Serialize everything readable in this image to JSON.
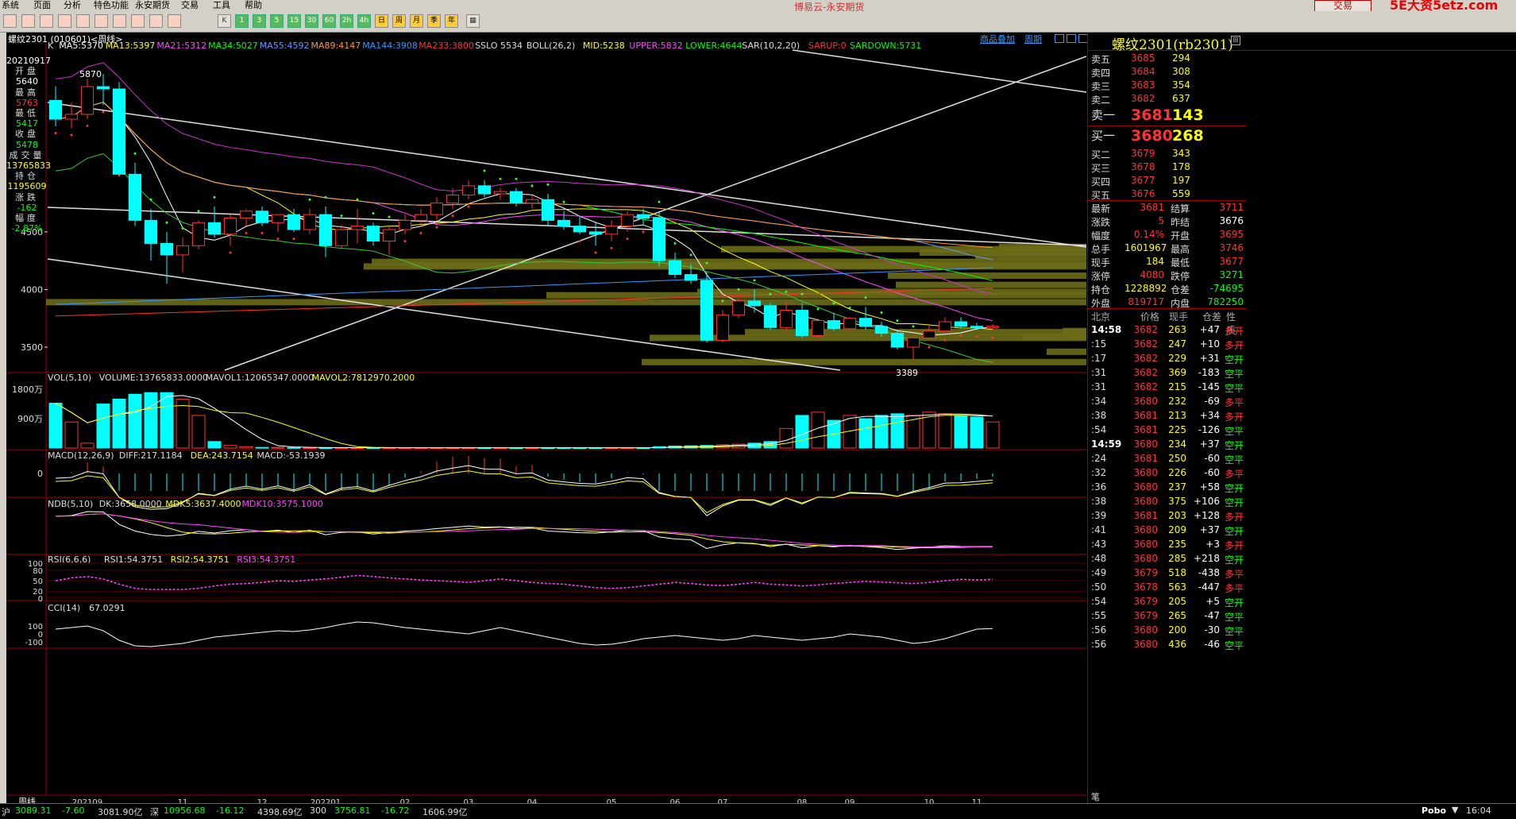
{
  "menu": {
    "items": [
      "系统",
      "页面",
      "分析",
      "特色功能",
      "永安期货",
      "交易",
      "工具",
      "帮助"
    ],
    "title": "博易云-永安期货",
    "trade_button": "交易",
    "brand": "5E大资5etz.com"
  },
  "toolbar": {
    "buttons": [
      "K",
      "1",
      "3",
      "5",
      "15",
      "30",
      "60",
      "2h",
      "4h",
      "日",
      "周",
      "月",
      "季",
      "年"
    ]
  },
  "chart": {
    "symbol_label": "螺纹2301 (010601)<周线>",
    "links": [
      "商品叠加",
      "周期"
    ],
    "ma_line": [
      {
        "text": "K",
        "color": "#dddddd"
      },
      {
        "text": "MA5:5370",
        "color": "#ffffff"
      },
      {
        "text": "MA13:5397",
        "color": "#ffff00"
      },
      {
        "text": "MA21:5312",
        "color": "#ff44ff"
      },
      {
        "text": "MA34:5027",
        "color": "#00ff00"
      },
      {
        "text": "MA55:4592",
        "color": "#6699ff"
      },
      {
        "text": "MA89:4147",
        "color": "#ff9933"
      },
      {
        "text": "MA144:3908",
        "color": "#3399ff"
      },
      {
        "text": "MA233:3800",
        "color": "#ff3333"
      },
      {
        "text": "SSLO 5534",
        "color": "#dddddd"
      },
      {
        "text": "BOLL(26,2)",
        "color": "#dddddd"
      },
      {
        "text": "MID:5238",
        "color": "#ffff00"
      },
      {
        "text": "UPPER:5832",
        "color": "#ff44ff"
      },
      {
        "text": "LOWER:4644",
        "color": "#00ff00"
      },
      {
        "text": "SAR(10,2,20)",
        "color": "#dddddd"
      },
      {
        "text": "SARUP:0",
        "color": "#ff3333"
      },
      {
        "text": "SARDOWN:5731",
        "color": "#00ff00"
      }
    ],
    "y_ticks": [
      "4500",
      "4000",
      "3500"
    ],
    "annot_high": "5870",
    "annot_low": "3389",
    "vol_header": [
      {
        "text": "VOL(5,10)",
        "color": "#dddddd"
      },
      {
        "text": "VOLUME:13765833.0000",
        "color": "#dddddd"
      },
      {
        "text": "MAVOL1:12065347.0000",
        "color": "#dddddd"
      },
      {
        "text": "MAVOL2:7812970.2000",
        "color": "#ffff00"
      }
    ],
    "vol_ticks": [
      "1800万",
      "900万"
    ],
    "macd_header": [
      {
        "text": "MACD(12,26,9)",
        "color": "#dddddd"
      },
      {
        "text": "DIFF:217.1184",
        "color": "#dddddd"
      },
      {
        "text": "DEA:243.7154",
        "color": "#ffff00"
      },
      {
        "text": "MACD:-53.1939",
        "color": "#dddddd"
      }
    ],
    "macd_tick": "0",
    "ndb_header": [
      {
        "text": "NDB(5,10)",
        "color": "#dddddd"
      },
      {
        "text": "DK:3658.0000",
        "color": "#dddddd"
      },
      {
        "text": "MDK5:3637.4000",
        "color": "#ffff00"
      },
      {
        "text": "MDK10:3575.1000",
        "color": "#ff44ff"
      }
    ],
    "rsi_header": [
      {
        "text": "RSI(6,6,6)",
        "color": "#dddddd"
      },
      {
        "text": "RSI1:54.3751",
        "color": "#dddddd"
      },
      {
        "text": "RSI2:54.3751",
        "color": "#ffff00"
      },
      {
        "text": "RSI3:54.3751",
        "color": "#ff44ff"
      }
    ],
    "rsi_ticks": [
      "100",
      "80",
      "50",
      "20",
      "0"
    ],
    "cci_header": [
      {
        "text": "CCI(14)",
        "color": "#dddddd"
      },
      {
        "text": "67.0291",
        "color": "#dddddd"
      }
    ],
    "cci_ticks": [
      "100",
      "0",
      "-100"
    ],
    "x_labels": [
      "202109",
      "11",
      "12",
      "202201",
      "02",
      "03",
      "04",
      "05",
      "06",
      "07",
      "08",
      "09",
      "10",
      "11"
    ],
    "period_label": "周线"
  },
  "info": {
    "date": "20210917",
    "rows": [
      {
        "label": "开盘",
        "value": "5640",
        "color": "#ffffff"
      },
      {
        "label": "最高",
        "value": "5763",
        "color": "#ff3333"
      },
      {
        "label": "最低",
        "value": "5417",
        "color": "#00ff00"
      },
      {
        "label": "收盘",
        "value": "5478",
        "color": "#00ff00"
      },
      {
        "label": "成交量",
        "value": "13765833",
        "color": "#ffff00"
      },
      {
        "label": "持仓",
        "value": "1195609",
        "color": "#ffff00"
      },
      {
        "label": "涨跌",
        "value": "-162",
        "color": "#00ff00"
      },
      {
        "label": "幅度",
        "value": "-2.87%",
        "color": "#00ff00"
      }
    ]
  },
  "chart_data": {
    "type": "candlestick",
    "periods": 60,
    "price_range": [
      3300,
      6050
    ],
    "candles": [
      [
        5640,
        5763,
        5417,
        5478
      ],
      [
        5478,
        5620,
        5400,
        5520
      ],
      [
        5520,
        5830,
        5480,
        5760
      ],
      [
        5760,
        5870,
        5600,
        5740
      ],
      [
        5740,
        5800,
        5050,
        5000
      ],
      [
        5000,
        5100,
        4550,
        4600
      ],
      [
        4600,
        4700,
        4250,
        4400
      ],
      [
        4400,
        4500,
        4050,
        4300
      ],
      [
        4300,
        4450,
        4150,
        4380
      ],
      [
        4380,
        4600,
        4350,
        4580
      ],
      [
        4580,
        4720,
        4450,
        4480
      ],
      [
        4480,
        4650,
        4380,
        4620
      ],
      [
        4620,
        4700,
        4550,
        4680
      ],
      [
        4680,
        4720,
        4550,
        4580
      ],
      [
        4580,
        4650,
        4500,
        4650
      ],
      [
        4650,
        4700,
        4500,
        4520
      ],
      [
        4520,
        4700,
        4480,
        4650
      ],
      [
        4650,
        4720,
        4280,
        4380
      ],
      [
        4380,
        4560,
        4350,
        4520
      ],
      [
        4520,
        4700,
        4400,
        4550
      ],
      [
        4550,
        4580,
        4380,
        4420
      ],
      [
        4420,
        4550,
        4300,
        4520
      ],
      [
        4520,
        4650,
        4480,
        4600
      ],
      [
        4600,
        4700,
        4550,
        4650
      ],
      [
        4650,
        4800,
        4600,
        4750
      ],
      [
        4750,
        4880,
        4700,
        4820
      ],
      [
        4820,
        4950,
        4780,
        4900
      ],
      [
        4900,
        4950,
        4800,
        4830
      ],
      [
        4830,
        4880,
        4780,
        4850
      ],
      [
        4850,
        4880,
        4720,
        4750
      ],
      [
        4750,
        4820,
        4700,
        4780
      ],
      [
        4780,
        4830,
        4550,
        4600
      ],
      [
        4600,
        4680,
        4520,
        4550
      ],
      [
        4550,
        4640,
        4480,
        4500
      ],
      [
        4500,
        4580,
        4380,
        4480
      ],
      [
        4480,
        4600,
        4420,
        4550
      ],
      [
        4550,
        4680,
        4500,
        4650
      ],
      [
        4650,
        4700,
        4560,
        4620
      ],
      [
        4620,
        4680,
        4200,
        4250
      ],
      [
        4250,
        4320,
        4100,
        4130
      ],
      [
        4130,
        4220,
        4050,
        4080
      ],
      [
        4080,
        4150,
        3540,
        3560
      ],
      [
        3560,
        3820,
        3540,
        3780
      ],
      [
        3780,
        3920,
        3750,
        3900
      ],
      [
        3900,
        4000,
        3800,
        3860
      ],
      [
        3860,
        3880,
        3650,
        3670
      ],
      [
        3670,
        3900,
        3640,
        3820
      ],
      [
        3820,
        3880,
        3580,
        3600
      ],
      [
        3600,
        3750,
        3580,
        3730
      ],
      [
        3730,
        3800,
        3640,
        3660
      ],
      [
        3660,
        3760,
        3640,
        3750
      ],
      [
        3750,
        3850,
        3650,
        3680
      ],
      [
        3680,
        3720,
        3590,
        3620
      ],
      [
        3620,
        3650,
        3480,
        3500
      ],
      [
        3500,
        3600,
        3389,
        3580
      ],
      [
        3580,
        3700,
        3560,
        3640
      ],
      [
        3640,
        3760,
        3620,
        3720
      ],
      [
        3720,
        3760,
        3660,
        3681
      ],
      [
        3681,
        3710,
        3650,
        3670
      ],
      [
        3670,
        3700,
        3640,
        3681
      ]
    ],
    "volume_wan": [
      1376,
      800,
      150,
      1350,
      1500,
      1650,
      1700,
      1700,
      1500,
      1000,
      200,
      80,
      40,
      20,
      20,
      15,
      10,
      10,
      10,
      10,
      10,
      10,
      10,
      10,
      10,
      10,
      10,
      10,
      10,
      10,
      10,
      10,
      10,
      10,
      10,
      10,
      10,
      10,
      40,
      60,
      70,
      80,
      100,
      120,
      150,
      200,
      600,
      1000,
      1100,
      850,
      1000,
      900,
      1000,
      1050,
      1000,
      1100,
      1050,
      1000,
      950,
      800
    ],
    "rsi": [
      50,
      58,
      62,
      55,
      40,
      28,
      25,
      25,
      25,
      28,
      35,
      40,
      42,
      45,
      50,
      48,
      52,
      55,
      60,
      65,
      62,
      58,
      55,
      52,
      50,
      48,
      45,
      50,
      55,
      50,
      45,
      42,
      40,
      35,
      30,
      28,
      30,
      35,
      40,
      45,
      42,
      38,
      36,
      40,
      45,
      40,
      38,
      35,
      38,
      42,
      45,
      48,
      46,
      44,
      42,
      45,
      50,
      54,
      52,
      54
    ],
    "cci": [
      60,
      80,
      100,
      40,
      -80,
      -150,
      -160,
      -140,
      -120,
      -80,
      -40,
      -20,
      0,
      20,
      40,
      30,
      50,
      80,
      120,
      150,
      140,
      110,
      80,
      60,
      40,
      20,
      0,
      40,
      80,
      40,
      0,
      -40,
      -80,
      -120,
      -140,
      -130,
      -100,
      -60,
      -40,
      -20,
      -40,
      -60,
      -80,
      -60,
      -20,
      -40,
      -60,
      -80,
      -60,
      -40,
      0,
      -20,
      -40,
      -80,
      -120,
      -100,
      -60,
      0,
      60,
      67
    ]
  },
  "quote": {
    "title": "螺纹2301(rb2301)",
    "asks": [
      {
        "label": "卖五",
        "price": "3685",
        "vol": "294"
      },
      {
        "label": "卖四",
        "price": "3684",
        "vol": "308"
      },
      {
        "label": "卖三",
        "price": "3683",
        "vol": "354"
      },
      {
        "label": "卖二",
        "price": "3682",
        "vol": "637"
      },
      {
        "label": "卖一",
        "price": "3681",
        "vol": "143"
      }
    ],
    "bids": [
      {
        "label": "买一",
        "price": "3680",
        "vol": "268"
      },
      {
        "label": "买二",
        "price": "3679",
        "vol": "343"
      },
      {
        "label": "买三",
        "price": "3678",
        "vol": "178"
      },
      {
        "label": "买四",
        "price": "3677",
        "vol": "197"
      },
      {
        "label": "买五",
        "price": "3676",
        "vol": "559"
      }
    ],
    "stats": [
      {
        "l1": "最新",
        "v1": "3681",
        "c1": "#ff3333",
        "l2": "结算",
        "v2": "3711",
        "c2": "#ff3333"
      },
      {
        "l1": "涨跌",
        "v1": "5",
        "c1": "#ff3333",
        "l2": "昨结",
        "v2": "3676",
        "c2": "#ffffff"
      },
      {
        "l1": "幅度",
        "v1": "0.14%",
        "c1": "#ff3333",
        "l2": "开盘",
        "v2": "3695",
        "c2": "#ff3333"
      },
      {
        "l1": "总手",
        "v1": "1601967",
        "c1": "#ffff00",
        "l2": "最高",
        "v2": "3746",
        "c2": "#ff3333"
      },
      {
        "l1": "现手",
        "v1": "184",
        "c1": "#ffff00",
        "l2": "最低",
        "v2": "3677",
        "c2": "#ff3333"
      },
      {
        "l1": "涨停",
        "v1": "4080",
        "c1": "#ff3333",
        "l2": "跌停",
        "v2": "3271",
        "c2": "#00ff00"
      },
      {
        "l1": "持仓",
        "v1": "1228892",
        "c1": "#ffff00",
        "l2": "仓差",
        "v2": "-74695",
        "c2": "#00ff00"
      },
      {
        "l1": "外盘",
        "v1": "819717",
        "c1": "#ff3333",
        "l2": "内盘",
        "v2": "782250",
        "c2": "#00ff00"
      }
    ],
    "tick_header": [
      "北京",
      "价格",
      "现手",
      "仓差",
      "性质"
    ],
    "ticks": [
      {
        "time": "14:58",
        "price": "3682",
        "vol": "263",
        "oi": "+47",
        "type": "多开"
      },
      {
        "time": ":15",
        "price": "3682",
        "vol": "247",
        "oi": "+10",
        "type": "多开"
      },
      {
        "time": ":17",
        "price": "3682",
        "vol": "229",
        "oi": "+31",
        "type": "空开"
      },
      {
        "time": ":31",
        "price": "3682",
        "vol": "369",
        "oi": "-183",
        "type": "空平"
      },
      {
        "time": ":31",
        "price": "3682",
        "vol": "215",
        "oi": "-145",
        "type": "空平"
      },
      {
        "time": ":34",
        "price": "3680",
        "vol": "232",
        "oi": "-69",
        "type": "多平"
      },
      {
        "time": ":38",
        "price": "3681",
        "vol": "213",
        "oi": "+34",
        "type": "多开"
      },
      {
        "time": ":54",
        "price": "3681",
        "vol": "225",
        "oi": "-126",
        "type": "空平"
      },
      {
        "time": "14:59",
        "price": "3680",
        "vol": "234",
        "oi": "+37",
        "type": "空开"
      },
      {
        "time": ":24",
        "price": "3681",
        "vol": "250",
        "oi": "-60",
        "type": "空平"
      },
      {
        "time": ":32",
        "price": "3680",
        "vol": "226",
        "oi": "-60",
        "type": "多平"
      },
      {
        "time": ":36",
        "price": "3680",
        "vol": "237",
        "oi": "+58",
        "type": "空开"
      },
      {
        "time": ":38",
        "price": "3680",
        "vol": "375",
        "oi": "+106",
        "type": "空开"
      },
      {
        "time": ":39",
        "price": "3681",
        "vol": "203",
        "oi": "+128",
        "type": "多开"
      },
      {
        "time": ":41",
        "price": "3680",
        "vol": "209",
        "oi": "+37",
        "type": "空开"
      },
      {
        "time": ":43",
        "price": "3680",
        "vol": "235",
        "oi": "+3",
        "type": "多开"
      },
      {
        "time": ":48",
        "price": "3680",
        "vol": "285",
        "oi": "+218",
        "type": "空开"
      },
      {
        "time": ":49",
        "price": "3679",
        "vol": "518",
        "oi": "-438",
        "type": "多平"
      },
      {
        "time": ":50",
        "price": "3678",
        "vol": "563",
        "oi": "-447",
        "type": "多平"
      },
      {
        "time": ":54",
        "price": "3679",
        "vol": "205",
        "oi": "+5",
        "type": "空开"
      },
      {
        "time": ":55",
        "price": "3679",
        "vol": "265",
        "oi": "-47",
        "type": "空平"
      },
      {
        "time": ":56",
        "price": "3680",
        "vol": "200",
        "oi": "-30",
        "type": "空平"
      },
      {
        "time": ":56",
        "price": "3680",
        "vol": "436",
        "oi": "-46",
        "type": "空平"
      }
    ]
  },
  "statusbar": {
    "items": [
      {
        "text": "沪",
        "color": "#dddddd"
      },
      {
        "text": "3089.31",
        "color": "#00ff00"
      },
      {
        "text": "-7.60",
        "color": "#00ff00"
      },
      {
        "text": "3081.90亿",
        "color": "#dddddd"
      },
      {
        "text": "深",
        "color": "#dddddd"
      },
      {
        "text": "10956.68",
        "color": "#00ff00"
      },
      {
        "text": "-16.12",
        "color": "#00ff00"
      },
      {
        "text": "4398.69亿",
        "color": "#dddddd"
      },
      {
        "text": "300",
        "color": "#dddddd"
      },
      {
        "text": "3756.81",
        "color": "#00ff00"
      },
      {
        "text": "-16.72",
        "color": "#00ff00"
      },
      {
        "text": "1606.99亿",
        "color": "#dddddd"
      }
    ],
    "right_brand": "Pobo",
    "time": "16:04",
    "bottom_left_label": "笔"
  }
}
